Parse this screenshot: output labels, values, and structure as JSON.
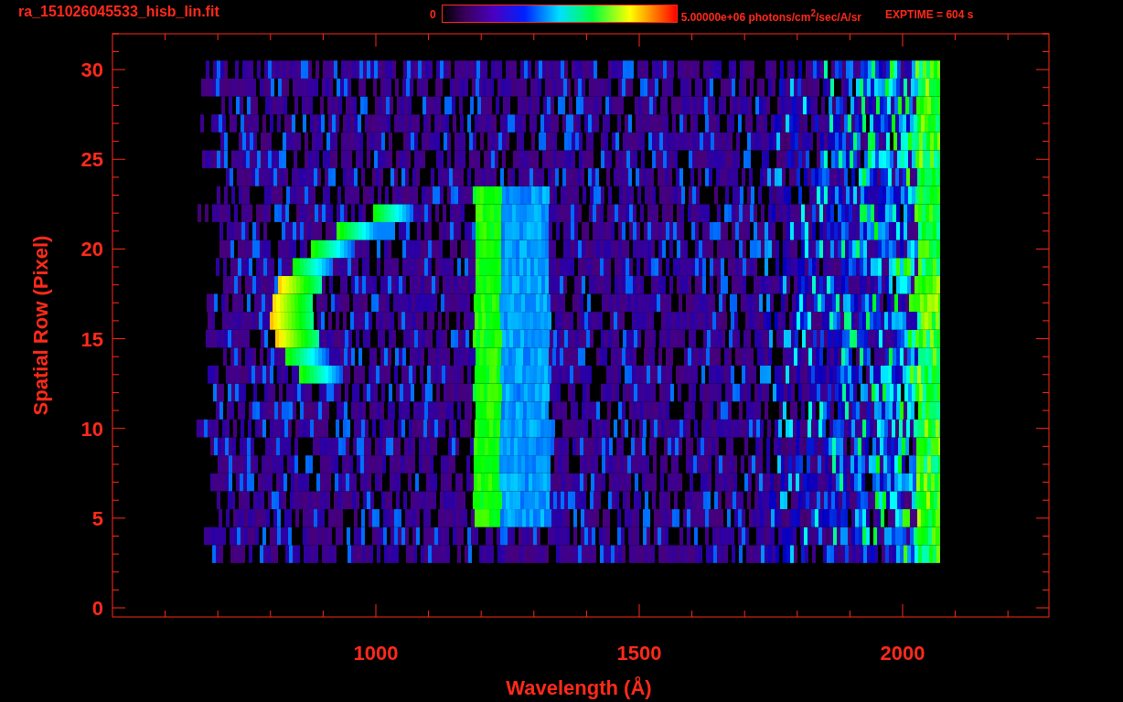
{
  "header": {
    "title": "ra_151026045533_hisb_lin.fit",
    "colorbar": {
      "min_label": "0",
      "max_label": "5.00000e+06 photons/cm$^{2}$/sec/A/sr"
    },
    "exposure": "EXPTIME = 604 s"
  },
  "plot": {
    "ylabel": "Spatial Row (Pixel)",
    "xlabel": "Wavelength (Å)",
    "xticks": [
      "1000",
      "1500",
      "2000"
    ],
    "yticks": [
      "30",
      "25",
      "20",
      "15",
      "10",
      "5",
      "0"
    ]
  }
}
